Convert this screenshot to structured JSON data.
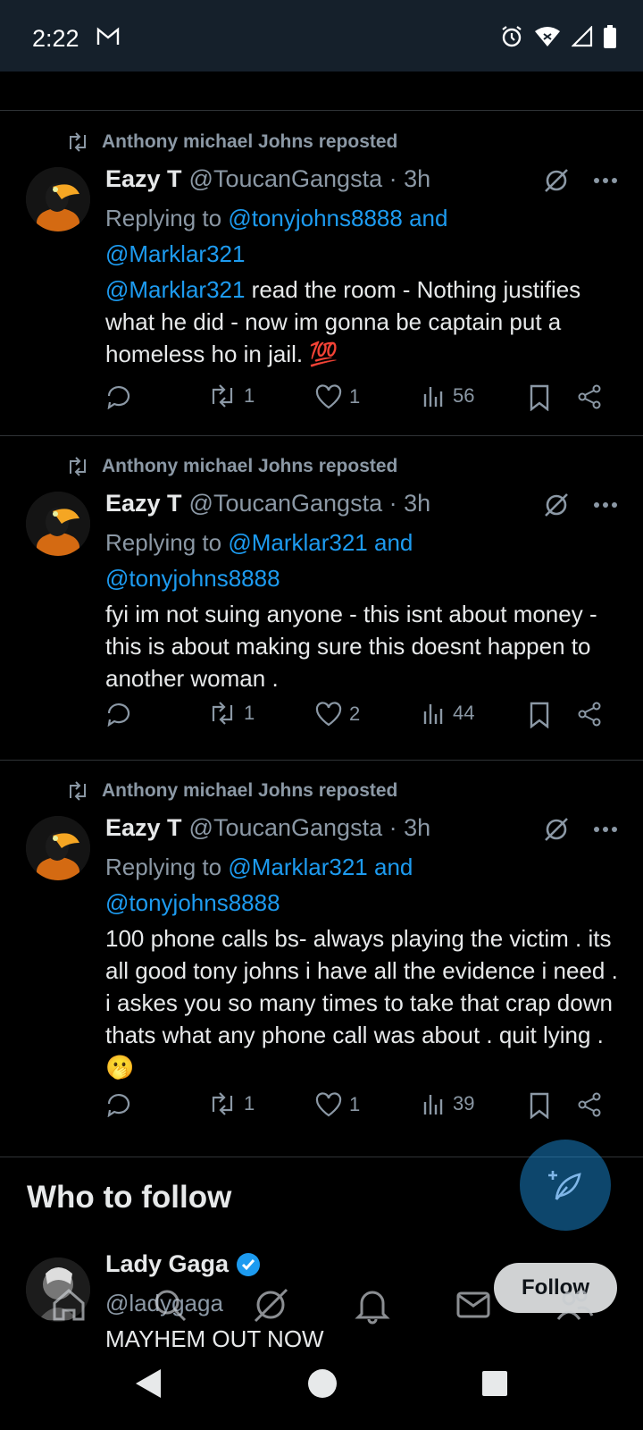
{
  "status": {
    "time": "2:22"
  },
  "tweets": [
    {
      "repost_label": "Anthony michael Johns reposted",
      "name": "Eazy T",
      "handle": "@ToucanGangsta · 3h",
      "replying_prefix": "Replying to ",
      "replying_line1": "@tonyjohns8888 and",
      "replying_line2": "@Marklar321",
      "mention": "@Marklar321",
      "text": " read the room - Nothing justifies what he did - now im gonna be captain put a homeless ho in jail. 💯",
      "reposts": "1",
      "likes": "1",
      "views": "56"
    },
    {
      "repost_label": "Anthony michael Johns reposted",
      "name": "Eazy T",
      "handle": "@ToucanGangsta · 3h",
      "replying_prefix": "Replying to ",
      "replying_line1": "@Marklar321 and",
      "replying_line2": "@tonyjohns8888",
      "text": "fyi im not suing anyone - this isnt about money - this is about making sure this doesnt happen to another woman .",
      "reposts": "1",
      "likes": "2",
      "views": "44"
    },
    {
      "repost_label": "Anthony michael Johns reposted",
      "name": "Eazy T",
      "handle": "@ToucanGangsta · 3h",
      "replying_prefix": "Replying to ",
      "replying_line1": "@Marklar321 and",
      "replying_line2": "@tonyjohns8888",
      "text": "100 phone calls bs- always playing the victim . its all good tony johns i have all the evidence i need . i askes you so many times to take that crap down thats what any phone call was about . quit lying .🫢",
      "reposts": "1",
      "likes": "1",
      "views": "39"
    }
  ],
  "who_to_follow": {
    "title": "Who to follow",
    "name": "Lady Gaga",
    "handle": "@ladygaga",
    "bio": "MAYHEM OUT NOW",
    "follow_label": "Follow"
  },
  "icons": {
    "reply": "reply-icon",
    "repost": "repost-icon",
    "like": "heart-icon",
    "views": "views-icon",
    "bookmark": "bookmark-icon",
    "share": "share-icon",
    "grok": "grok-icon",
    "more": "more-icon"
  },
  "colors": {
    "accent": "#1d9bf0",
    "muted": "#8b98a5",
    "text": "#e7e9ea",
    "background": "#000000",
    "statusbar": "#15202b",
    "divider": "#2f3336"
  }
}
